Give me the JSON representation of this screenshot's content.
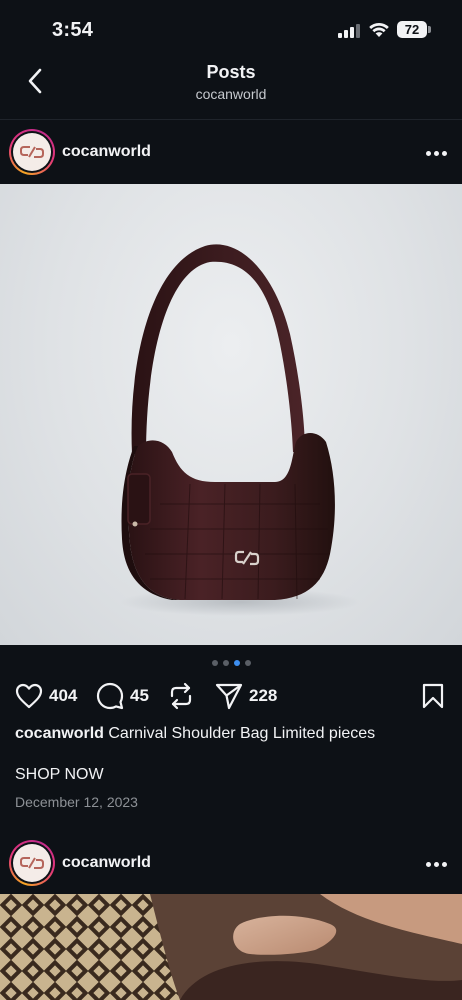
{
  "status_bar": {
    "time": "3:54",
    "battery": "72"
  },
  "header": {
    "title": "Posts",
    "subtitle": "cocanworld"
  },
  "post1": {
    "username": "cocanworld",
    "carousel": {
      "count": 4,
      "active_index": 2
    },
    "likes": "404",
    "comments": "45",
    "shares": "228",
    "caption_user": "cocanworld",
    "caption_text": "Carnival Shoulder Bag Limited pieces",
    "cta": "SHOP NOW",
    "date": "December 12, 2023"
  },
  "post2": {
    "username": "cocanworld"
  },
  "colors": {
    "background": "#0d1116",
    "text": "#f2f3f5",
    "muted": "#8d9196",
    "dot_active": "#3d8ff0",
    "bag": "#3b1c1c"
  },
  "icons": [
    "back-chevron-icon",
    "heart-icon",
    "comment-icon",
    "repost-icon",
    "send-icon",
    "bookmark-icon",
    "more-icon"
  ]
}
